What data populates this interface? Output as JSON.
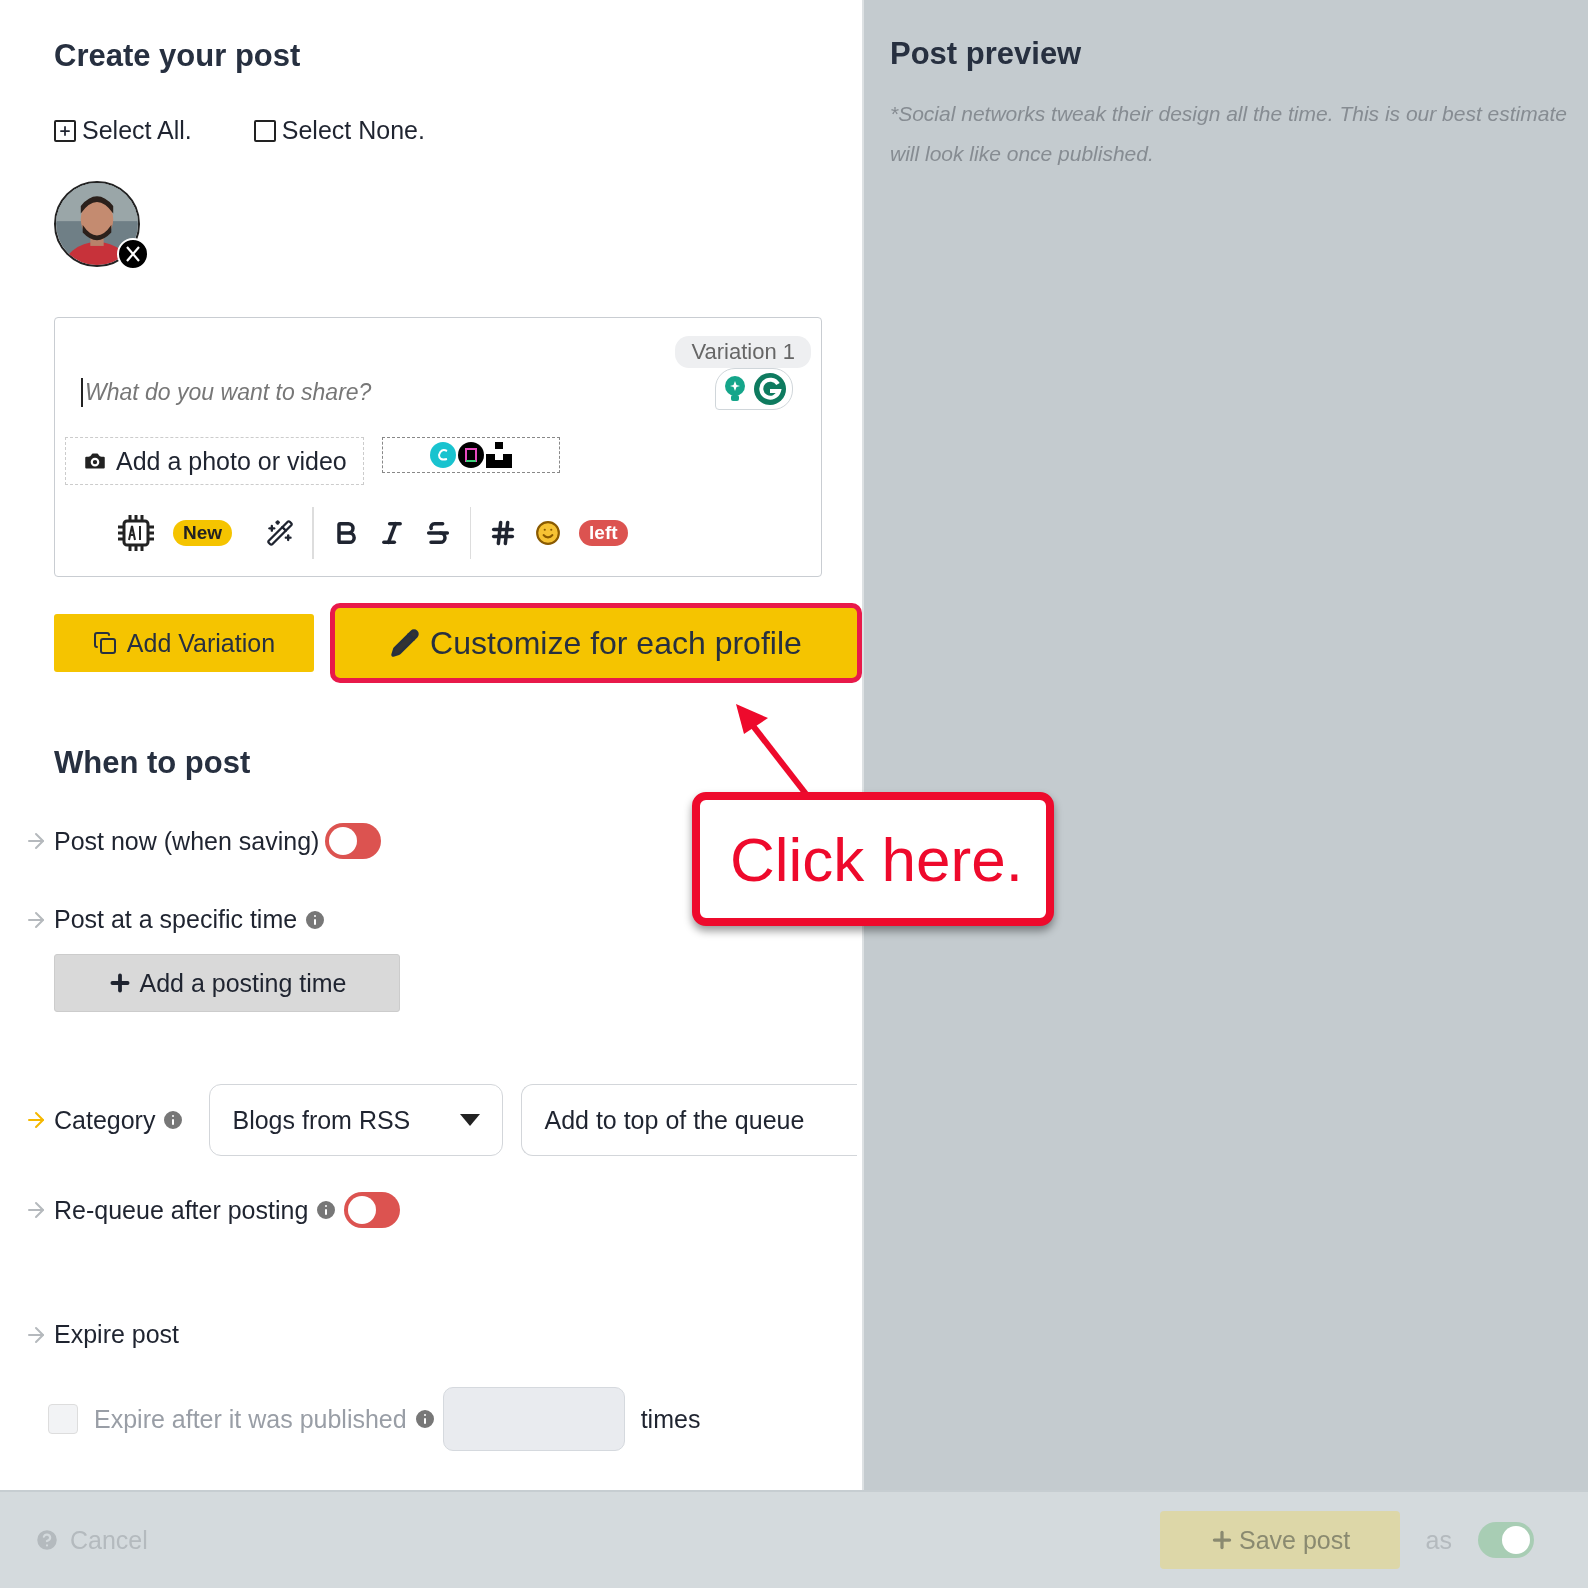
{
  "title": "Create your post",
  "selection": [
    {
      "kind": "all",
      "label": "Select All."
    },
    {
      "kind": "none",
      "label": "Select None."
    }
  ],
  "editor": {
    "variation": "Variation 1",
    "placeholder": "What do you want to share?",
    "media_button": "Add a photo or video",
    "new_badge": "New",
    "counter_badge": "left"
  },
  "add_variation": "Add Variation",
  "customize": {
    "label": "Customize for each profile",
    "highlighted": true
  },
  "when": {
    "title": "When to post",
    "post_now": {
      "label": "Post now (when saving)",
      "on": false,
      "accent": false
    },
    "specific": {
      "label": "Post at a specific time",
      "accent": false
    },
    "add_time": "Add a posting time"
  },
  "category": {
    "label": "Category",
    "value": "Blogs from RSS",
    "queue": "Add to top of the queue",
    "accent": true
  },
  "requeue": {
    "label": "Re-queue after posting",
    "on": false,
    "accent": false
  },
  "expire": {
    "title": "Expire post",
    "label": "Expire after it was published",
    "checked": false,
    "disabled": true,
    "unit": "times",
    "accent": false
  },
  "preview": {
    "title": "Post preview",
    "note": [
      "*Social networks tweak their design all the time. This is our best estimate",
      "will look like once published."
    ]
  },
  "footer": {
    "cancel": "Cancel",
    "save": "Save post",
    "as": "as",
    "on": true
  },
  "callout": "Click here."
}
